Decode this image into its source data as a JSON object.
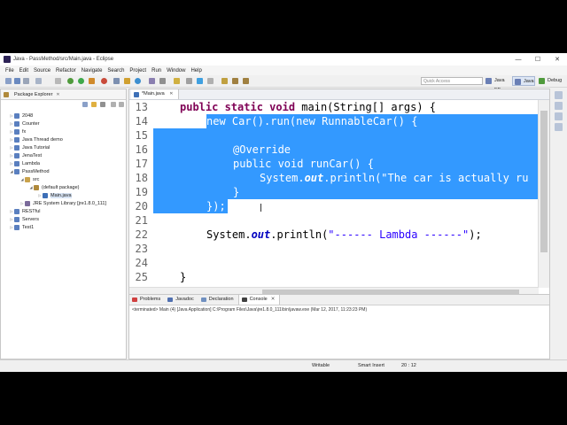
{
  "window": {
    "title": "Java - PassMethod/src/Main.java - Eclipse",
    "minimize": "—",
    "maximize": "☐",
    "close": "✕"
  },
  "menu": [
    "File",
    "Edit",
    "Source",
    "Refactor",
    "Navigate",
    "Search",
    "Project",
    "Run",
    "Window",
    "Help"
  ],
  "toolbar": {
    "quick_access_placeholder": "Quick Access",
    "perspectives": [
      "Java EE",
      "Java",
      "Debug"
    ]
  },
  "package_explorer": {
    "title": "Package Explorer",
    "items": [
      {
        "label": "2048",
        "icon": "project-icon"
      },
      {
        "label": "Counter",
        "icon": "project-icon"
      },
      {
        "label": "fx",
        "icon": "project-icon"
      },
      {
        "label": "Java Thread demo",
        "icon": "project-icon"
      },
      {
        "label": "Java Tutorial",
        "icon": "project-icon"
      },
      {
        "label": "JenaTest",
        "icon": "project-icon"
      },
      {
        "label": "Lambda",
        "icon": "project-icon"
      },
      {
        "label": "PassMethod",
        "icon": "project-icon"
      },
      {
        "label": "src",
        "icon": "source-folder-icon"
      },
      {
        "label": "(default package)",
        "icon": "package-icon"
      },
      {
        "label": "Main.java",
        "icon": "java-file-icon"
      },
      {
        "label": "JRE System Library [jre1.8.0_111]",
        "icon": "library-icon"
      },
      {
        "label": "RESTful",
        "icon": "project-icon"
      },
      {
        "label": "Servers",
        "icon": "project-icon"
      },
      {
        "label": "Test1",
        "icon": "project-icon"
      }
    ]
  },
  "editor": {
    "tab_label": "*Main.java",
    "line_numbers": [
      "13",
      "14",
      "15",
      "16",
      "17",
      "18",
      "19",
      "20",
      "21",
      "22",
      "23",
      "24",
      "25"
    ]
  },
  "code": {
    "l13_kw": "public static void",
    "l13_rest": " main(String[] args) {",
    "l14_kw": "new",
    "l14_a": " Car().run(",
    "l14_kw2": "new",
    "l14_b": " RunnableCar() {",
    "l16": "@Override",
    "l17_kw": "public void",
    "l17_rest": " runCar() {",
    "l18_a": "System.",
    "l18_out": "out",
    "l18_b": ".println(",
    "l18_str": "\"The car is actually ru",
    "l19": "}",
    "l20": "});",
    "l22_a": "System.",
    "l22_out": "out",
    "l22_b": ".println(",
    "l22_str": "\"------ Lambda ------\"",
    "l22_c": ");",
    "l25": "}"
  },
  "console": {
    "tabs": [
      "Problems",
      "Javadoc",
      "Declaration",
      "Console"
    ],
    "active_tab": "Console",
    "text": "<terminated> Main (4) [Java Application] C:\\Program Files\\Java\\jre1.8.0_111\\bin\\javaw.exe (Mar 12, 2017, 11:23:23 PM)"
  },
  "status": {
    "writable": "Writable",
    "insert_mode": "Smart Insert",
    "position": "20 : 12"
  },
  "colors": {
    "selection": "#3399ff",
    "keyword": "#7f0055",
    "string": "#2a00ff",
    "field": "#0000c0",
    "annotation": "#646464"
  }
}
